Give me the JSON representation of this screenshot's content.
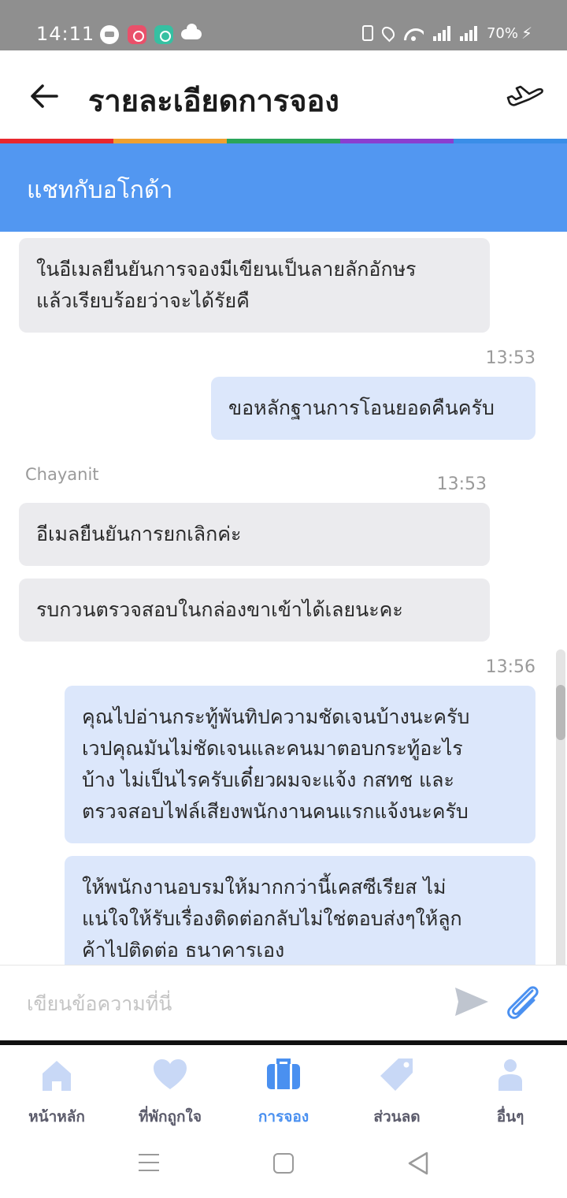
{
  "status_bar": {
    "time": "14:11",
    "battery": "70%",
    "icons": [
      "line-icon",
      "app-icon",
      "app-icon",
      "cloud-icon",
      "vibrate-icon",
      "location-icon",
      "wifi-icon",
      "signal-icon",
      "signal-icon",
      "charging-icon"
    ]
  },
  "header": {
    "title": "รายละเอียดการจอง",
    "back_icon": "arrow-left-icon",
    "right_icon": "airplane-icon"
  },
  "rainbow_colors": [
    "#e8272e",
    "#f0a030",
    "#2aa55a",
    "#8a3ed0",
    "#3a8ee8"
  ],
  "chat": {
    "banner_label": "แชทกับอโกด้า",
    "messages": [
      {
        "dir": "in",
        "lines": [
          "ในอีเมลยืนยันการจองมีเขียนเป็นลายลักอักษร",
          "แล้วเรียบร้อยว่าจะได้รัยคื"
        ]
      },
      {
        "dir": "out",
        "time": "13:53",
        "lines": [
          "ขอหลักฐานการโอนยอดคืนครับ"
        ]
      },
      {
        "dir": "in",
        "sender": "Chayanit",
        "time": "13:53",
        "lines": [
          "อีเมลยืนยันการยกเลิกค่ะ"
        ]
      },
      {
        "dir": "in",
        "lines": [
          "รบกวนตรวจสอบในกล่องขาเข้าได้เลยนะคะ"
        ]
      },
      {
        "dir": "out",
        "time": "13:56",
        "lines": [
          "คุณไปอ่านกระทู้พันทิปความชัดเจนบ้างนะครับ",
          "เวปคุณมันไม่ชัดเจนและคนมาตอบกระทู้อะไร",
          "บ้าง ไม่เป็นไรครับเดี๋ยวผมจะแจ้ง กสทช และ",
          "ตรวจสอบไฟล์เสียงพนักงานคนแรกแจ้งนะครับ"
        ]
      },
      {
        "dir": "out",
        "lines": [
          "ให้พนักงานอบรมให้มากกว่านี้เคสซีเรียส ไม่",
          "แน่ใจให้รับเรื่องติดต่อกลับไม่ใช่ตอบส่งๆให้ลูก",
          "ค้าไปติดต่อ ธนาคารเอง"
        ]
      }
    ]
  },
  "composer": {
    "placeholder": "เขียนข้อความที่นี่",
    "value": "",
    "send_icon": "send-icon",
    "attach_icon": "paperclip-icon"
  },
  "bottom_nav": {
    "items": [
      {
        "label": "หน้าหลัก",
        "icon": "home-icon",
        "active": false
      },
      {
        "label": "ที่พักถูกใจ",
        "icon": "heart-icon",
        "active": false
      },
      {
        "label": "การจอง",
        "icon": "suitcase-icon",
        "active": true
      },
      {
        "label": "ส่วนลด",
        "icon": "tag-icon",
        "active": false
      },
      {
        "label": "อื่นๆ",
        "icon": "person-icon",
        "active": false
      }
    ]
  },
  "colors": {
    "banner": "#5297f1",
    "incoming_bubble": "#ebebee",
    "outgoing_bubble": "#dce7fb",
    "active_nav": "#4a90f0",
    "inactive_icon": "#c8d8f6"
  }
}
